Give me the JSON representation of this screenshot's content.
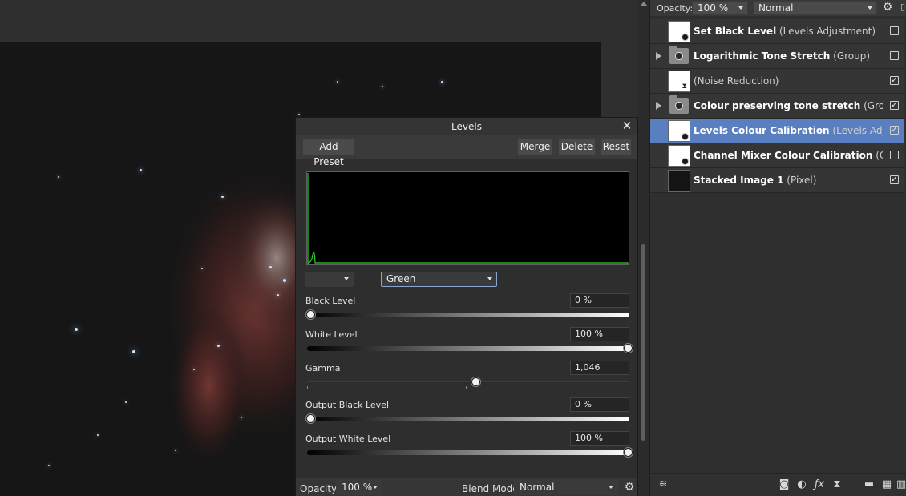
{
  "layers_panel": {
    "opacity_label": "Opacity:",
    "opacity_value": "100 %",
    "blend_mode": "Normal",
    "layers": [
      {
        "name": "Set Black Level",
        "type": " (Levels Adjustment)",
        "checked": false,
        "selected": false,
        "kind": "adjustment",
        "expandable": false
      },
      {
        "name": "Logarithmic Tone Stretch",
        "type": " (Group)",
        "checked": false,
        "selected": false,
        "kind": "group",
        "expandable": true
      },
      {
        "name": "",
        "type": "(Noise Reduction)",
        "checked": true,
        "selected": false,
        "kind": "filter",
        "expandable": false
      },
      {
        "name": "Colour preserving tone stretch",
        "type": " (Group)",
        "checked": true,
        "selected": false,
        "kind": "group",
        "expandable": true
      },
      {
        "name": "Levels Colour Calibration",
        "type": " (Levels Adjust…",
        "checked": true,
        "selected": true,
        "kind": "adjustment",
        "expandable": false
      },
      {
        "name": "Channel Mixer Colour Calibration",
        "type": " (Chan…",
        "checked": false,
        "selected": false,
        "kind": "adjustment",
        "expandable": false
      },
      {
        "name": "Stacked Image 1",
        "type": " (Pixel)",
        "checked": true,
        "selected": false,
        "kind": "pixel",
        "expandable": false
      }
    ],
    "bottom_icons": [
      "layers-icon",
      "mask-icon",
      "adjustment-icon",
      "fx-icon",
      "live-filter-icon",
      "folder-icon",
      "grid-icon",
      "trash-icon"
    ]
  },
  "levels_dialog": {
    "title": "Levels",
    "close_glyph": "✕",
    "buttons": {
      "add_preset": "Add Preset",
      "merge": "Merge",
      "delete": "Delete",
      "reset": "Reset"
    },
    "preset_select": "",
    "channel_select": "Green",
    "histogram_color": "#30d030",
    "sliders": [
      {
        "label": "Black Level",
        "value": "0 %",
        "position": 0.0,
        "style": "to-white"
      },
      {
        "label": "White Level",
        "value": "100 %",
        "position": 1.0,
        "style": "to-black"
      },
      {
        "label": "Gamma",
        "value": "1,046",
        "position": 0.52,
        "style": "plain"
      },
      {
        "label": "Output Black Level",
        "value": "0 %",
        "position": 0.0,
        "style": "to-white"
      },
      {
        "label": "Output White Level",
        "value": "100 %",
        "position": 1.0,
        "style": "to-black"
      }
    ],
    "opacity_label": "Opacity:",
    "opacity_value": "100 %",
    "blend_mode_label": "Blend Mode:",
    "blend_mode_value": "Normal"
  },
  "colors": {
    "selection": "#5a7fc0",
    "panel": "#2f2f2f",
    "histogram": "#30d030"
  }
}
